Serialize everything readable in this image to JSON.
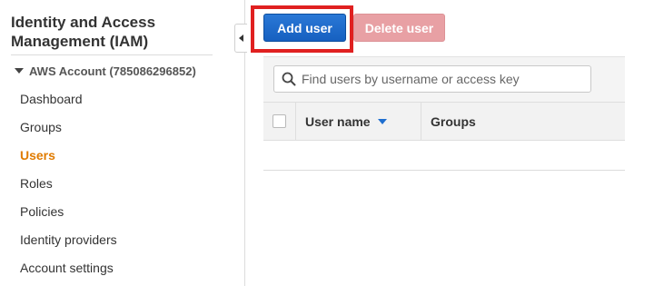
{
  "sidebar": {
    "title": "Identity and Access Management (IAM)",
    "account": "AWS Account (785086296852)",
    "items": [
      {
        "label": "Dashboard",
        "active": false
      },
      {
        "label": "Groups",
        "active": false
      },
      {
        "label": "Users",
        "active": true
      },
      {
        "label": "Roles",
        "active": false
      },
      {
        "label": "Policies",
        "active": false
      },
      {
        "label": "Identity providers",
        "active": false
      },
      {
        "label": "Account settings",
        "active": false
      }
    ]
  },
  "toolbar": {
    "add_user_label": "Add user",
    "delete_user_label": "Delete user"
  },
  "search": {
    "placeholder": "Find users by username or access key",
    "value": ""
  },
  "table": {
    "columns": [
      "User name",
      "Groups"
    ],
    "sorted_column": "User name",
    "sort_direction": "descending"
  },
  "colors": {
    "primary_button": "#1f6fd0",
    "danger_button_disabled": "#e8a0a4",
    "active_nav": "#e07b00",
    "highlight_box": "#e02020"
  }
}
